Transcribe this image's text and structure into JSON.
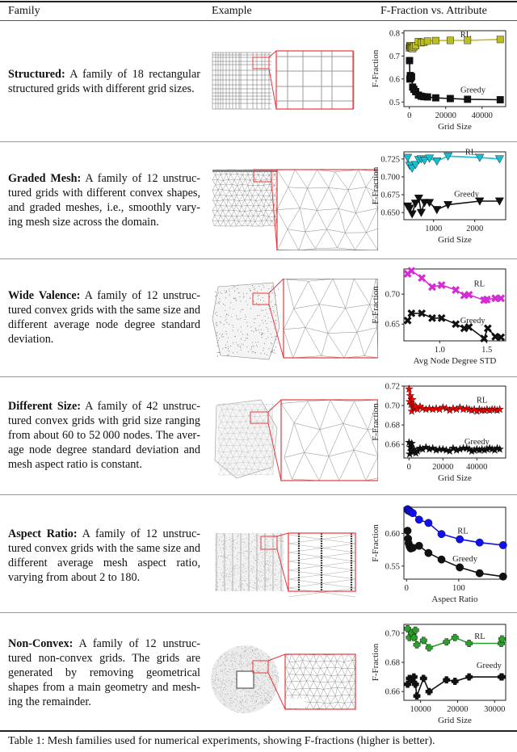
{
  "table": {
    "headers": {
      "family": "Family",
      "example": "Example",
      "chart": "F-Fraction vs. Attribute"
    },
    "caption": "Table 1: Mesh families used for numerical experiments, showing F-fractions (higher is better).",
    "rows": [
      {
        "name": "Structured:",
        "text": " A family of 18 rectangular structured grids with different grid sizes.",
        "example": "structured"
      },
      {
        "name": "Graded Mesh:",
        "text": " A family of 12 unstruc­tured grids with different convex shapes, and graded meshes, i.e., smoothly vary­ing mesh size across the domain.",
        "example": "graded"
      },
      {
        "name": "Wide Valence:",
        "text": " A family of 12 unstruc­tured convex grids with the same size and different average node degree stan­dard deviation.",
        "example": "valence"
      },
      {
        "name": "Different Size:",
        "text": " A family of 42 unstruc­tured convex grids with grid size ranging from about 60 to 52 000 nodes. The aver­age node degree standard deviation and mesh aspect ratio is constant.",
        "example": "size"
      },
      {
        "name": "Aspect Ratio:",
        "text": " A family of 12 unstruc­tured convex grids with the same size and different average mesh aspect ratio, varying from about 2 to 180.",
        "example": "aspect"
      },
      {
        "name": "Non-Convex:",
        "text": " A family of 12 unstruc­tured non-convex grids. The grids are generated by removing geometrical shapes from a main geometry and mesh­ing the remainder.",
        "example": "nonconvex"
      }
    ]
  },
  "colors": {
    "structured": "#bcbd22",
    "graded": "#17becf",
    "valence": "#d62ad6",
    "size": "#ff0000",
    "aspect": "#1010ee",
    "nonconvex": "#2ca02c",
    "greedy": "#111111",
    "zoom_box": "#e8383d"
  },
  "chart_data": [
    {
      "type": "line",
      "title": "",
      "xlabel": "Grid Size",
      "ylabel": "F-Fraction",
      "xlim": [
        -3000,
        53000
      ],
      "ylim": [
        0.48,
        0.81
      ],
      "xticks": [
        0,
        20000,
        40000
      ],
      "xtick_labels": [
        "0",
        "20000",
        "40000"
      ],
      "yticks": [
        0.5,
        0.6,
        0.7,
        0.8
      ],
      "ytick_labels": [
        "0.5",
        "0.6",
        "0.7",
        "0.8"
      ],
      "marker": "square",
      "series": [
        {
          "name": "RL",
          "color": "#bcbd22",
          "x": [
            100,
            300,
            500,
            800,
            1200,
            1800,
            2500,
            3500,
            5000,
            6500,
            8000,
            10000,
            14500,
            22500,
            32000,
            50000
          ],
          "y": [
            0.735,
            0.745,
            0.74,
            0.738,
            0.735,
            0.732,
            0.74,
            0.745,
            0.763,
            0.758,
            0.76,
            0.765,
            0.767,
            0.768,
            0.768,
            0.772
          ]
        },
        {
          "name": "Greedy",
          "color": "#111111",
          "x": [
            100,
            300,
            500,
            800,
            1200,
            1800,
            2500,
            3500,
            5000,
            6500,
            8000,
            10000,
            14500,
            22500,
            32000,
            50000
          ],
          "y": [
            0.68,
            0.6,
            0.615,
            0.605,
            0.61,
            0.565,
            0.555,
            0.545,
            0.53,
            0.525,
            0.523,
            0.522,
            0.518,
            0.515,
            0.512,
            0.51
          ]
        }
      ],
      "labels": [
        {
          "text": "RL",
          "x": 31000,
          "y": 0.782
        },
        {
          "text": "Greedy",
          "x": 35000,
          "y": 0.542
        }
      ]
    },
    {
      "type": "line",
      "title": "",
      "xlabel": "Grid Size",
      "ylabel": "F-Fraction",
      "xlim": [
        280,
        2750
      ],
      "ylim": [
        0.64,
        0.735
      ],
      "xticks": [
        1000,
        2000
      ],
      "xtick_labels": [
        "1000",
        "2000"
      ],
      "yticks": [
        0.65,
        0.675,
        0.7,
        0.725
      ],
      "ytick_labels": [
        "0.650",
        "0.675",
        "0.700",
        "0.725"
      ],
      "marker": "triangle-down",
      "series": [
        {
          "name": "RL",
          "color": "#17becf",
          "x": [
            370,
            420,
            480,
            560,
            640,
            700,
            780,
            900,
            1080,
            1350,
            2120,
            2600
          ],
          "y": [
            0.727,
            0.716,
            0.712,
            0.717,
            0.724,
            0.725,
            0.723,
            0.726,
            0.722,
            0.729,
            0.727,
            0.725
          ]
        },
        {
          "name": "Greedy",
          "color": "#111111",
          "x": [
            370,
            420,
            480,
            560,
            640,
            700,
            780,
            900,
            1080,
            1350,
            2120,
            2600
          ],
          "y": [
            0.659,
            0.656,
            0.648,
            0.663,
            0.67,
            0.65,
            0.664,
            0.664,
            0.654,
            0.661,
            0.666,
            0.666
          ]
        }
      ],
      "labels": [
        {
          "text": "RL",
          "x": 1900,
          "y": 0.731
        },
        {
          "text": "Greedy",
          "x": 1800,
          "y": 0.672
        }
      ]
    },
    {
      "type": "line",
      "title": "",
      "xlabel": "Avg Node Degree STD",
      "ylabel": "F-Fraction",
      "xlim": [
        0.62,
        1.7
      ],
      "ylim": [
        0.622,
        0.742
      ],
      "xticks": [
        1.0,
        1.5
      ],
      "xtick_labels": [
        "1.0",
        "1.5"
      ],
      "yticks": [
        0.65,
        0.7
      ],
      "ytick_labels": [
        "0.65",
        "0.70"
      ],
      "marker": "cross",
      "series": [
        {
          "name": "RL",
          "color": "#d62ad6",
          "x": [
            0.66,
            0.7,
            0.81,
            0.92,
            1.02,
            1.17,
            1.26,
            1.31,
            1.47,
            1.5,
            1.59,
            1.65
          ],
          "y": [
            0.734,
            0.739,
            0.727,
            0.712,
            0.715,
            0.707,
            0.698,
            0.699,
            0.69,
            0.691,
            0.693,
            0.693
          ]
        },
        {
          "name": "Greedy",
          "color": "#111111",
          "x": [
            0.66,
            0.7,
            0.81,
            0.92,
            1.02,
            1.17,
            1.26,
            1.31,
            1.47,
            1.51,
            1.59,
            1.65
          ],
          "y": [
            0.656,
            0.668,
            0.668,
            0.66,
            0.66,
            0.65,
            0.643,
            0.645,
            0.626,
            0.643,
            0.629,
            0.628
          ]
        }
      ],
      "labels": [
        {
          "text": "RL",
          "x": 1.42,
          "y": 0.713
        },
        {
          "text": "Greedy",
          "x": 1.35,
          "y": 0.652
        }
      ]
    },
    {
      "type": "line",
      "title": "",
      "xlabel": "Grid Size",
      "ylabel": "F-Fraction",
      "xlim": [
        -3000,
        57000
      ],
      "ylim": [
        0.646,
        0.72
      ],
      "xticks": [
        0,
        20000,
        40000
      ],
      "xtick_labels": [
        "0",
        "20000",
        "40000"
      ],
      "yticks": [
        0.66,
        0.68,
        0.7,
        0.72
      ],
      "ytick_labels": [
        "0.66",
        "0.68",
        "0.70",
        "0.72"
      ],
      "marker": "star",
      "series": [
        {
          "name": "RL",
          "color": "#ff0000",
          "x": [
            60,
            400,
            800,
            1200,
            1600,
            2000,
            2500,
            3000,
            4000,
            5000,
            6500,
            8000,
            10000,
            12000,
            14000,
            16000,
            18000,
            20000,
            22000,
            24000,
            26000,
            28000,
            30000,
            32000,
            34000,
            35500,
            37000,
            38500,
            40000,
            41500,
            43000,
            44500,
            46000,
            47500,
            49000,
            50500,
            52000,
            53500
          ],
          "y": [
            0.717,
            0.704,
            0.71,
            0.701,
            0.694,
            0.706,
            0.7,
            0.697,
            0.699,
            0.696,
            0.699,
            0.697,
            0.696,
            0.697,
            0.696,
            0.697,
            0.696,
            0.698,
            0.697,
            0.695,
            0.697,
            0.696,
            0.698,
            0.696,
            0.697,
            0.696,
            0.695,
            0.696,
            0.694,
            0.696,
            0.695,
            0.695,
            0.696,
            0.695,
            0.696,
            0.696,
            0.695,
            0.696
          ]
        },
        {
          "name": "Greedy",
          "color": "#111111",
          "x": [
            60,
            400,
            800,
            1200,
            1600,
            2000,
            2500,
            3000,
            4000,
            5000,
            6500,
            8000,
            10000,
            12000,
            14000,
            16000,
            18000,
            20000,
            22000,
            24000,
            26000,
            28000,
            30000,
            32000,
            34000,
            35500,
            37000,
            38500,
            40000,
            41500,
            43000,
            44500,
            46000,
            47500,
            49000,
            50500,
            52000,
            53500
          ],
          "y": [
            0.662,
            0.65,
            0.657,
            0.653,
            0.661,
            0.654,
            0.652,
            0.655,
            0.651,
            0.653,
            0.656,
            0.655,
            0.657,
            0.655,
            0.656,
            0.654,
            0.655,
            0.655,
            0.654,
            0.653,
            0.656,
            0.654,
            0.655,
            0.656,
            0.656,
            0.655,
            0.653,
            0.654,
            0.655,
            0.654,
            0.655,
            0.654,
            0.655,
            0.656,
            0.655,
            0.654,
            0.656,
            0.655
          ]
        }
      ],
      "labels": [
        {
          "text": "RL",
          "x": 43000,
          "y": 0.703
        },
        {
          "text": "Greedy",
          "x": 40000,
          "y": 0.66
        }
      ]
    },
    {
      "type": "line",
      "title": "",
      "xlabel": "Aspect Ratio",
      "ylabel": "F-Fraction",
      "xlim": [
        -5,
        190
      ],
      "ylim": [
        0.53,
        0.64
      ],
      "xticks": [
        0,
        100
      ],
      "xtick_labels": [
        "0",
        "100"
      ],
      "yticks": [
        0.55,
        0.6
      ],
      "ytick_labels": [
        "0.55",
        "0.60"
      ],
      "marker": "circle",
      "series": [
        {
          "name": "RL",
          "color": "#1010ee",
          "x": [
            2,
            3,
            4,
            6,
            8,
            12,
            24,
            42,
            67,
            102,
            140,
            185
          ],
          "y": [
            0.637,
            0.635,
            0.636,
            0.634,
            0.633,
            0.631,
            0.621,
            0.616,
            0.599,
            0.591,
            0.586,
            0.582
          ]
        },
        {
          "name": "Greedy",
          "color": "#111111",
          "x": [
            2,
            3,
            4,
            6,
            8,
            12,
            24,
            42,
            67,
            102,
            140,
            185
          ],
          "y": [
            0.604,
            0.592,
            0.585,
            0.58,
            0.577,
            0.578,
            0.581,
            0.57,
            0.56,
            0.548,
            0.539,
            0.534
          ]
        }
      ],
      "labels": [
        {
          "text": "RL",
          "x": 108,
          "y": 0.6
        },
        {
          "text": "Greedy",
          "x": 112,
          "y": 0.557
        }
      ]
    },
    {
      "type": "line",
      "title": "",
      "xlabel": "Grid Size",
      "ylabel": "F-Fraction",
      "xlim": [
        5500,
        33000
      ],
      "ylim": [
        0.654,
        0.706
      ],
      "xticks": [
        10000,
        20000,
        30000
      ],
      "xtick_labels": [
        "10000",
        "20000",
        "30000"
      ],
      "yticks": [
        0.66,
        0.68,
        0.7
      ],
      "ytick_labels": [
        "0.66",
        "0.68",
        "0.70"
      ],
      "marker": "plus",
      "series": [
        {
          "name": "RL",
          "color": "#2ca02c",
          "x": [
            6500,
            7000,
            7600,
            8200,
            8600,
            9000,
            10800,
            12300,
            17000,
            19300,
            23100,
            31800,
            32000
          ],
          "y": [
            0.703,
            0.697,
            0.7,
            0.697,
            0.702,
            0.692,
            0.695,
            0.69,
            0.694,
            0.697,
            0.693,
            0.693,
            0.696
          ]
        },
        {
          "name": "Greedy",
          "color": "#111111",
          "x": [
            6500,
            7000,
            7600,
            8200,
            8600,
            9000,
            10800,
            12300,
            17000,
            19300,
            23100,
            31800,
            32000
          ],
          "y": [
            0.665,
            0.669,
            0.668,
            0.67,
            0.665,
            0.657,
            0.669,
            0.66,
            0.668,
            0.667,
            0.67,
            0.67,
            0.67
          ]
        }
      ],
      "labels": [
        {
          "text": "RL",
          "x": 26000,
          "y": 0.696
        },
        {
          "text": "Greedy",
          "x": 28500,
          "y": 0.676
        }
      ]
    }
  ]
}
